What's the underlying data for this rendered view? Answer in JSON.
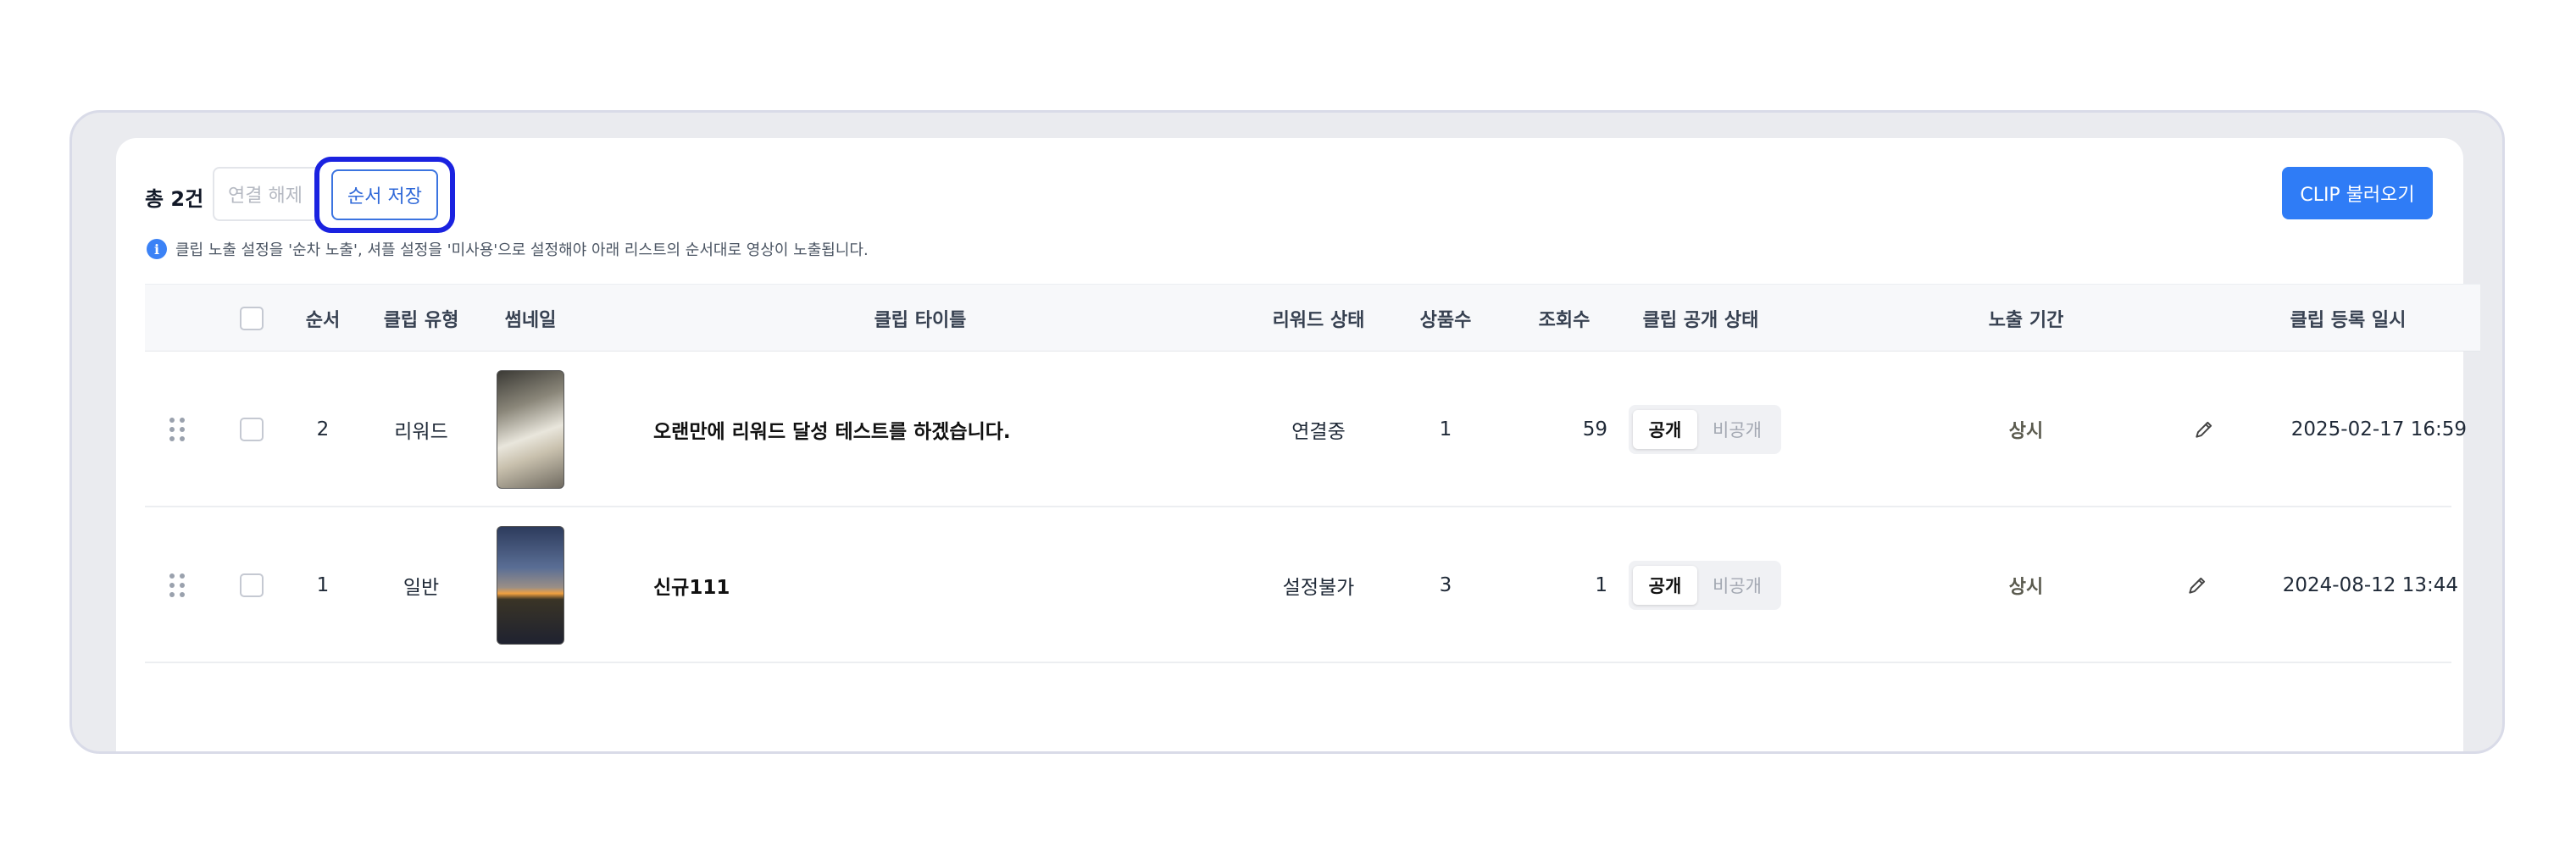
{
  "toolbar": {
    "total_label": "총 2건",
    "unlink_label": "연결 해제",
    "save_order_label": "순서 저장",
    "import_clip_label": "CLIP 불러오기",
    "info_icon_glyph": "i",
    "info_text": "클립 노출 설정을 '순차 노출', 셔플 설정을 '미사용'으로 설정해야 아래 리스트의 순서대로 영상이 노출됩니다."
  },
  "table": {
    "headers": {
      "order": "순서",
      "clip_type": "클립 유형",
      "thumbnail": "썸네일",
      "clip_title": "클립 타이틀",
      "reward_status": "리워드 상태",
      "product_count": "상품수",
      "view_count": "조회수",
      "visibility": "클립 공개 상태",
      "exposure_period": "노출 기간",
      "registered_at": "클립 등록 일시"
    },
    "rows": [
      {
        "order": "2",
        "clip_type": "리워드",
        "thumbnail": "cat-photo",
        "title": "오랜만에 리워드 달성 테스트를 하겠습니다.",
        "reward_status": "연결중",
        "product_count": "1",
        "view_count": "59",
        "public_label": "공개",
        "private_label": "비공개",
        "period": "상시",
        "registered_at": "2025-02-17 16:59"
      },
      {
        "order": "1",
        "clip_type": "일반",
        "thumbnail": "sunset-photo",
        "title": "신규111",
        "reward_status": "설정불가",
        "product_count": "3",
        "view_count": "1",
        "public_label": "공개",
        "private_label": "비공개",
        "period": "상시",
        "registered_at": "2024-08-12 13:44"
      }
    ]
  },
  "colors": {
    "primary": "#2f7cf6",
    "highlight": "#1a22e0",
    "background": "#eaebef"
  },
  "icons": [
    "info-icon",
    "drag-handle-icon",
    "checkbox",
    "pencil-icon"
  ]
}
